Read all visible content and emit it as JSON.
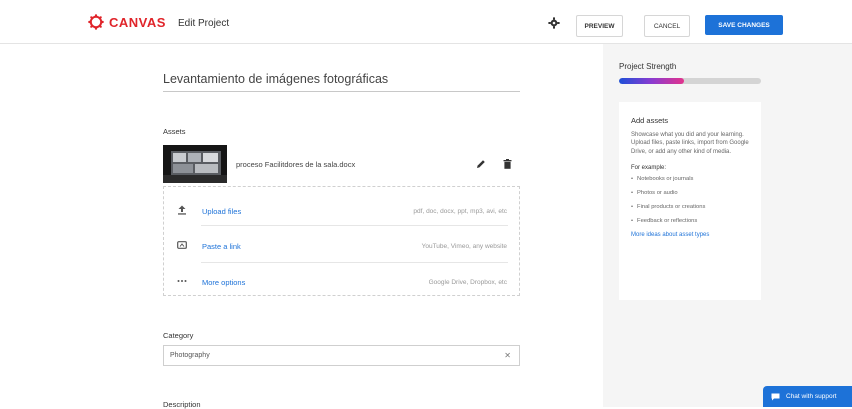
{
  "header": {
    "brand": "CANVAS",
    "page_title": "Edit Project",
    "preview_label": "PREVIEW",
    "cancel_label": "CANCEL",
    "save_label": "SAVE CHANGES"
  },
  "form": {
    "project_title": "Levantamiento de imágenes fotográficas",
    "assets_label": "Assets",
    "asset": {
      "file_name": "proceso Facilitdores de la sala.docx"
    },
    "upload_options": [
      {
        "label": "Upload files",
        "hint": "pdf, doc, docx, ppt, mp3, avi, etc",
        "icon": "upload-icon"
      },
      {
        "label": "Paste a link",
        "hint": "YouTube, Vimeo, any website",
        "icon": "link-icon"
      },
      {
        "label": "More options",
        "hint": "Google Drive, Dropbox, etc",
        "icon": "more-icon"
      }
    ],
    "category_label": "Category",
    "category_value": "Photography",
    "description_label": "Description"
  },
  "sidebar": {
    "strength_label": "Project Strength",
    "strength_fraction": 0.46,
    "tips_title": "Add assets",
    "tips_text": "Showcase what you did and your learning. Upload files, paste links, import from Google Drive, or add any other kind of media.",
    "tips_subhead": "For example:",
    "tips_items": [
      "Notebooks or journals",
      "Photos or audio",
      "Final products or creations",
      "Feedback or reflections"
    ],
    "tips_link": "More ideas about asset types"
  },
  "chat": {
    "label": "Chat with support"
  },
  "colors": {
    "brand_red": "#e0242a",
    "primary_blue": "#1d72d8"
  }
}
